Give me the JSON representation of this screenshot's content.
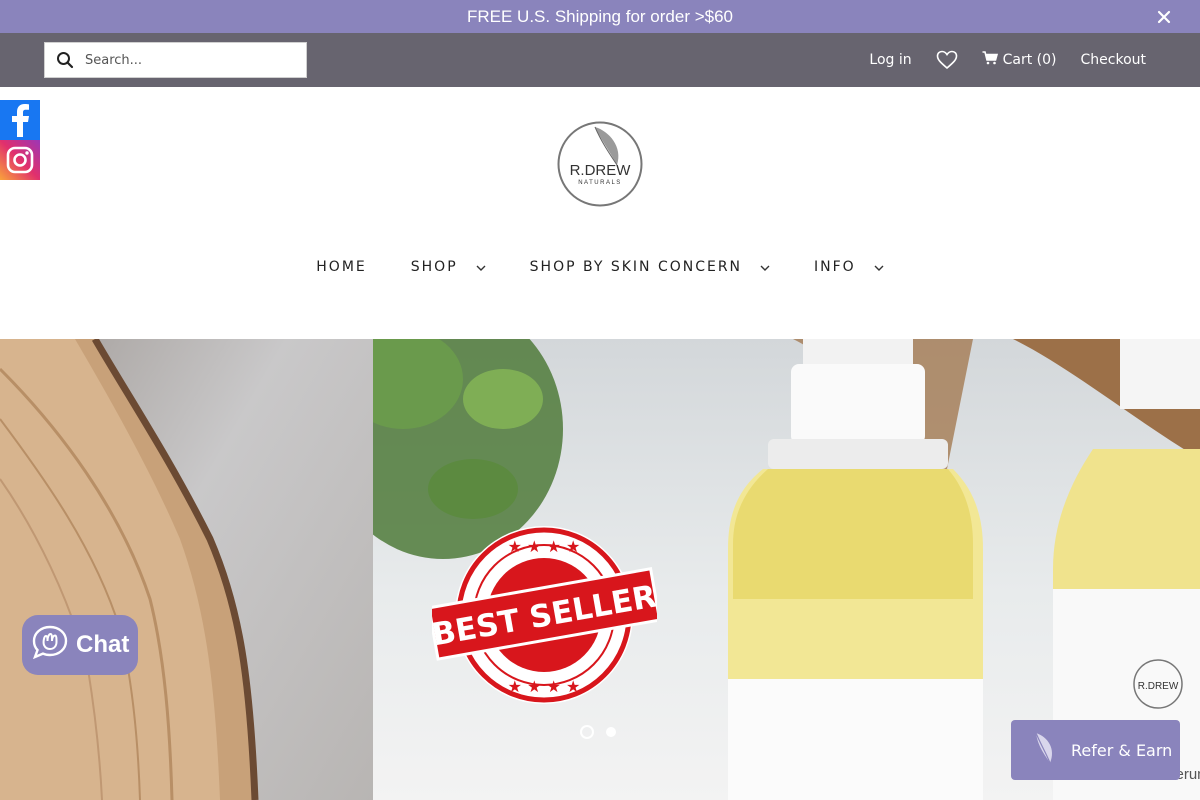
{
  "announcement": {
    "text": "FREE U.S. Shipping for order >$60",
    "close_icon": "close-icon"
  },
  "topbar": {
    "search_placeholder": "Search...",
    "login": "Log in",
    "wishlist_icon": "heart-icon",
    "cart": "Cart (0)",
    "checkout": "Checkout"
  },
  "logo": {
    "line1": "R.DREW",
    "line2": "NATURALS"
  },
  "nav": [
    {
      "label": "HOME"
    },
    {
      "label": "SHOP"
    },
    {
      "label": "SHOP BY SKIN CONCERN"
    },
    {
      "label": "INFO"
    }
  ],
  "hero": {
    "badge_text": "BEST SELLER",
    "bottle_brand": "R.DREW",
    "bottle_partial": "Oil Serum"
  },
  "slider": {
    "current_slide": 2,
    "total_slides": 2
  },
  "chat": {
    "label": "Chat"
  },
  "refer": {
    "label": "Refer & Earn"
  },
  "colors": {
    "accent": "#8a84bc",
    "topbar": "#67646f"
  }
}
